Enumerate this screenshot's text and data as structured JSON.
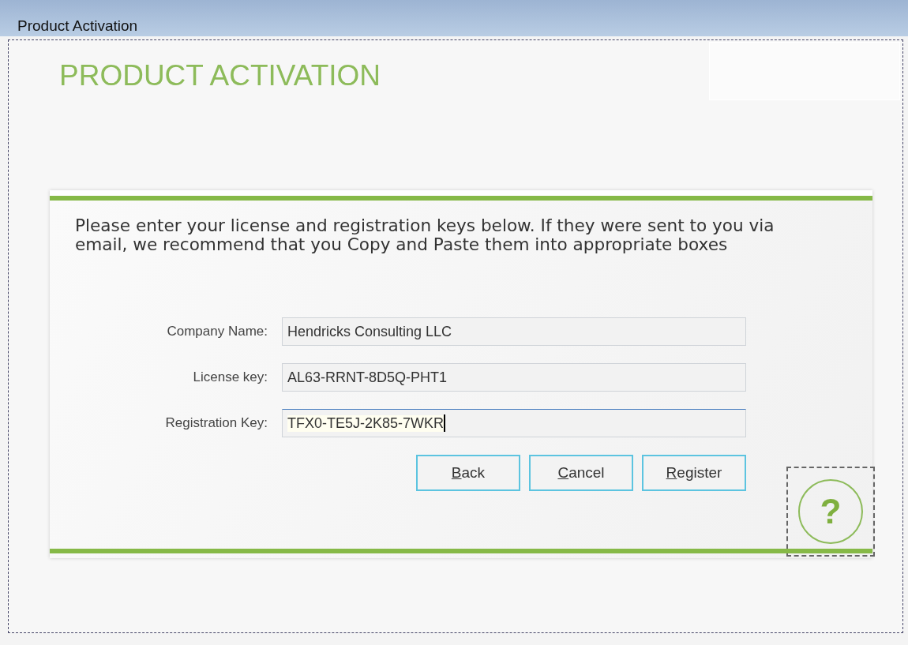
{
  "window": {
    "title": "Product Activation"
  },
  "heading": "PRODUCT ACTIVATION",
  "instructions": "Please enter your license and registration keys below. If they were sent to you via email, we recommend that you Copy and Paste them into appropriate boxes",
  "fields": [
    {
      "label": "Company Name:",
      "value": "Hendricks Consulting LLC",
      "focused": false
    },
    {
      "label": "License key:",
      "value": "AL63-RRNT-8D5Q-PHT1",
      "focused": false
    },
    {
      "label": "Registration Key:",
      "value": "TFX0-TE5J-2K85-7WKR",
      "focused": true
    }
  ],
  "buttons": [
    {
      "label": "Back",
      "mnemonic": true
    },
    {
      "label": "Cancel",
      "mnemonic": true
    },
    {
      "label": "Register",
      "mnemonic": true
    }
  ],
  "help": {
    "label": "?"
  }
}
